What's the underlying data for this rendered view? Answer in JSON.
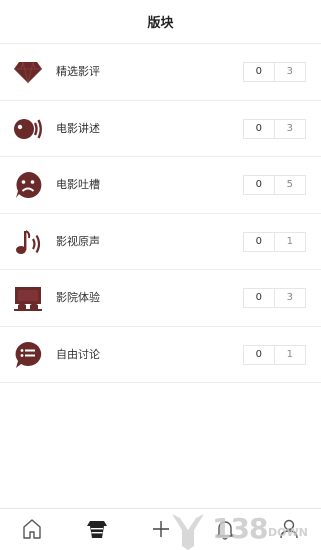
{
  "header": {
    "title": "版块"
  },
  "sections": [
    {
      "icon": "diamond-icon",
      "label": "精选影评",
      "count_left": "0",
      "count_right": "3"
    },
    {
      "icon": "speaker-speech-icon",
      "label": "电影讲述",
      "count_left": "0",
      "count_right": "3"
    },
    {
      "icon": "sad-face-icon",
      "label": "电影吐槽",
      "count_left": "0",
      "count_right": "5"
    },
    {
      "icon": "music-note-icon",
      "label": "影视原声",
      "count_left": "0",
      "count_right": "1"
    },
    {
      "icon": "cinema-screen-icon",
      "label": "影院体验",
      "count_left": "0",
      "count_right": "3"
    },
    {
      "icon": "chat-bubble-icon",
      "label": "自由讨论",
      "count_left": "0",
      "count_right": "1"
    }
  ],
  "tabbar": {
    "tabs": [
      {
        "icon": "home-icon",
        "active": false
      },
      {
        "icon": "forum-icon",
        "active": true
      },
      {
        "icon": "plus-icon",
        "active": false
      },
      {
        "icon": "bell-icon",
        "active": false
      },
      {
        "icon": "profile-icon",
        "active": false
      }
    ]
  },
  "watermark": {
    "text": "138",
    "subtext": "DOWN"
  },
  "colors": {
    "accent": "#6b2a2a",
    "border": "#ececec",
    "text": "#333333"
  }
}
